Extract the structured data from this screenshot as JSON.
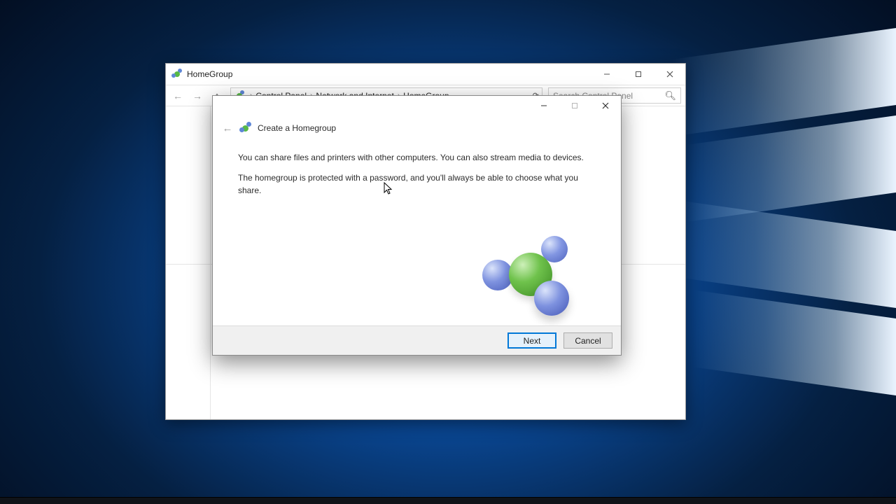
{
  "parent_window": {
    "title": "HomeGroup",
    "breadcrumb": {
      "root": "Control Panel",
      "mid": "Network and Internet",
      "leaf": "HomeGroup"
    },
    "search_placeholder": "Search Control Panel"
  },
  "dialog": {
    "title": "Create a Homegroup",
    "body_line1": "You can share files and printers with other computers. You can also stream media to devices.",
    "body_line2": "The homegroup is protected with a password, and you'll always be able to choose what you share.",
    "buttons": {
      "next": "Next",
      "cancel": "Cancel"
    }
  }
}
